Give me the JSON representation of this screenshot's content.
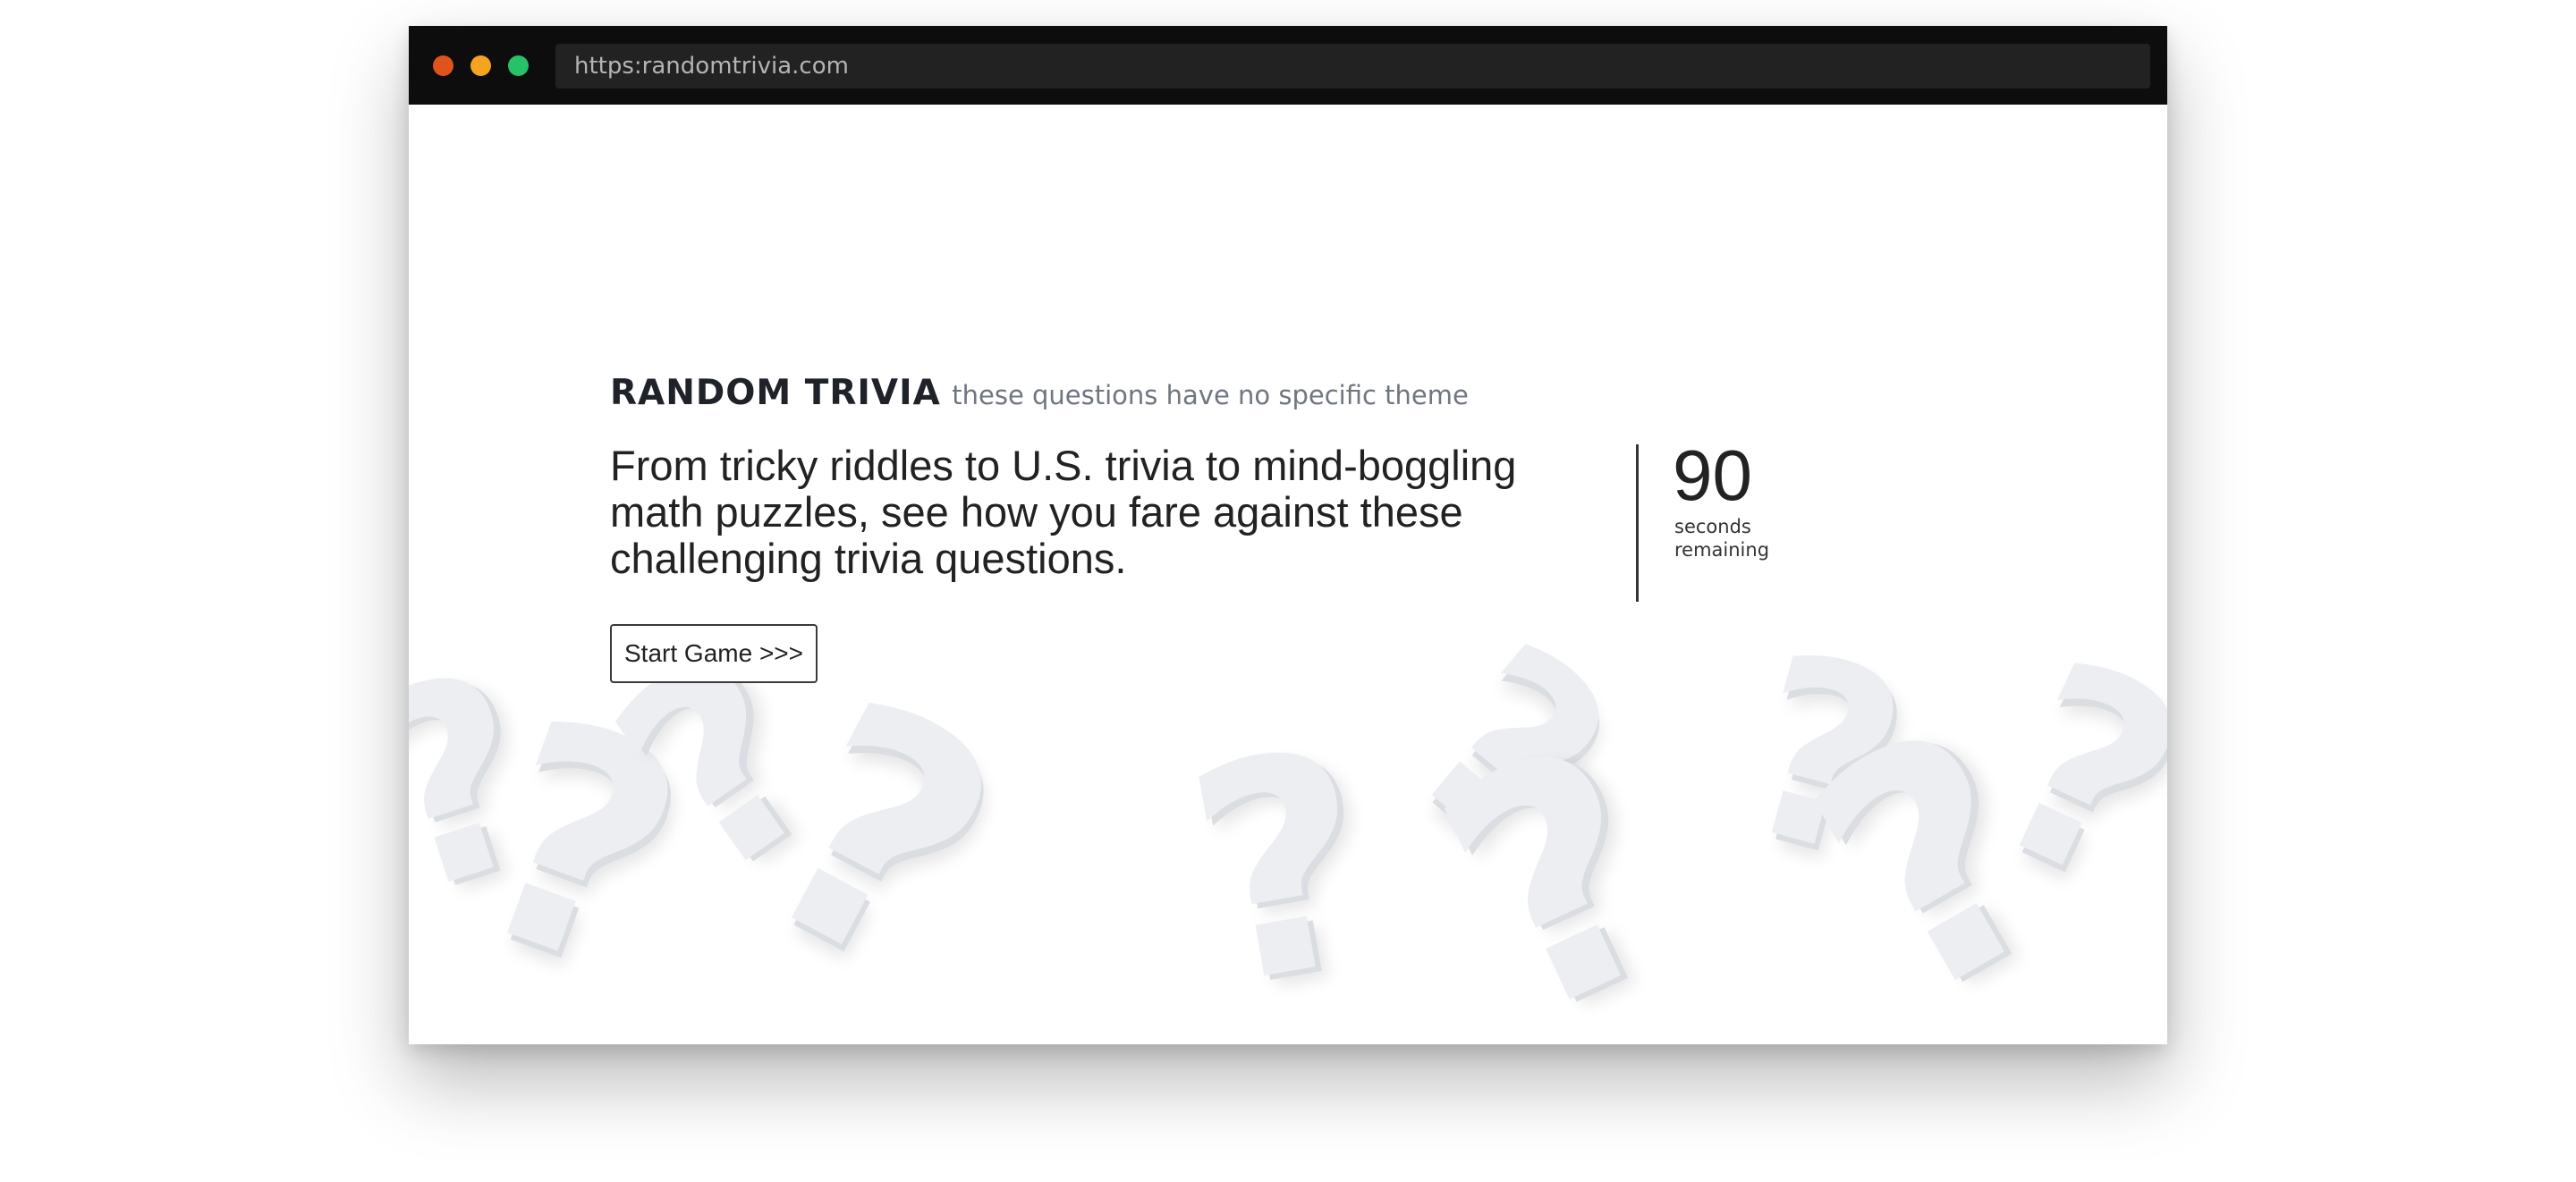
{
  "browser": {
    "url": "https:randomtrivia.com",
    "dot_colors": {
      "close": "#e0531c",
      "minimize": "#f4a41e",
      "maximize": "#27c167"
    }
  },
  "page": {
    "brand": "RANDOM TRIVIA",
    "tagline": "these questions have no specific theme",
    "description": "From tricky riddles to U.S. trivia to mind-boggling math puzzles, see how you fare against these challenging trivia questions.",
    "timer": {
      "value": "90",
      "label": "seconds remaining"
    },
    "start_button": "Start Game >>>",
    "background_icon": "question-mark-icon"
  }
}
